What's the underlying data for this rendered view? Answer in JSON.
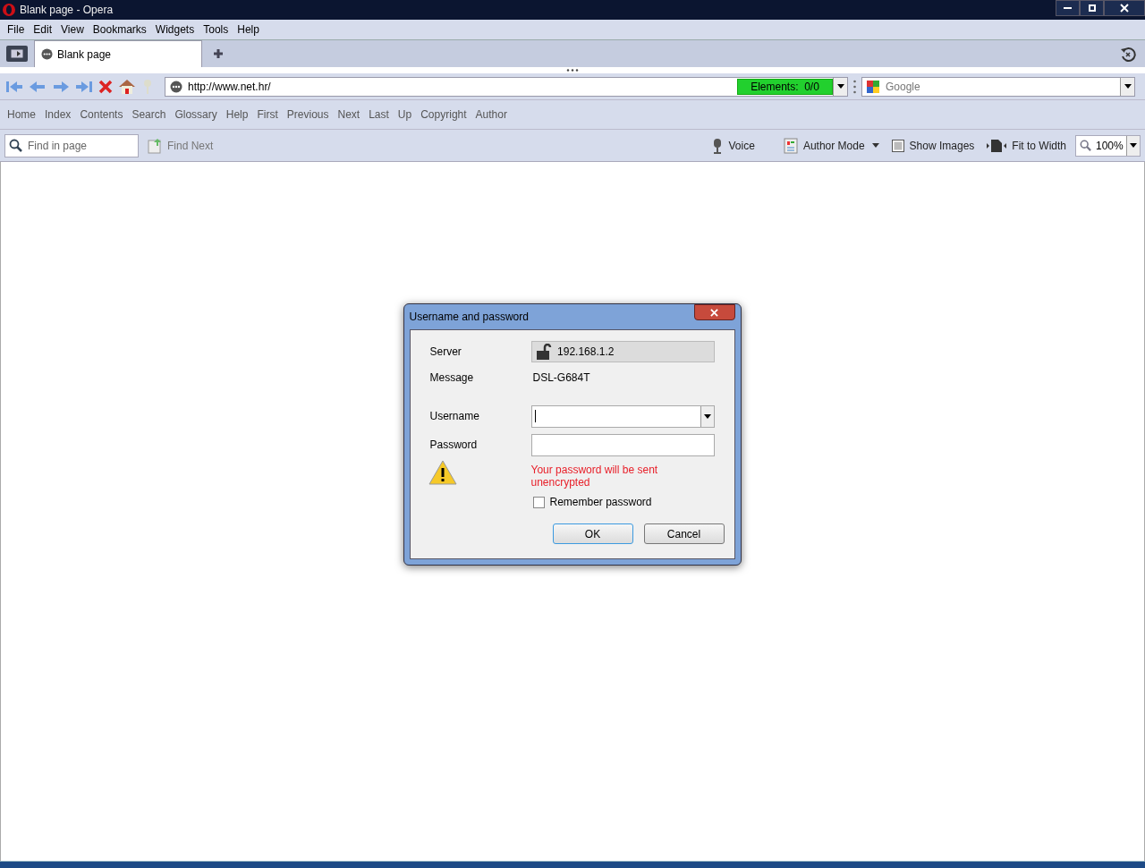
{
  "window": {
    "title": "Blank page - Opera"
  },
  "menu": [
    "File",
    "Edit",
    "View",
    "Bookmarks",
    "Widgets",
    "Tools",
    "Help"
  ],
  "tabs": [
    {
      "label": "Blank page",
      "selected": true
    }
  ],
  "address": {
    "url": "http://www.net.hr/",
    "elements": "Elements:  0/0",
    "search_placeholder": "Google"
  },
  "nav_links": [
    "Home",
    "Index",
    "Contents",
    "Search",
    "Glossary",
    "Help",
    "First",
    "Previous",
    "Next",
    "Last",
    "Up",
    "Copyright",
    "Author"
  ],
  "find_bar": {
    "placeholder": "Find in page",
    "find_next": "Find Next",
    "tools": [
      "Voice",
      "Author Mode",
      "Show Images",
      "Fit to Width"
    ],
    "zoom": "100%"
  },
  "dialog": {
    "title": "Username and password",
    "fields": [
      {
        "kind": "server",
        "label": "Server",
        "value": "192.168.1.2"
      },
      {
        "kind": "text",
        "label": "Message",
        "value": "DSL-G684T"
      },
      {
        "kind": "combo",
        "label": "Username"
      },
      {
        "kind": "password",
        "label": "Password"
      }
    ],
    "warning": "Your password will be sent unencrypted",
    "remember": {
      "label": "Remember password",
      "checked": false
    },
    "buttons": [
      {
        "label": "OK",
        "default": true
      },
      {
        "label": "Cancel",
        "default": false
      }
    ]
  }
}
